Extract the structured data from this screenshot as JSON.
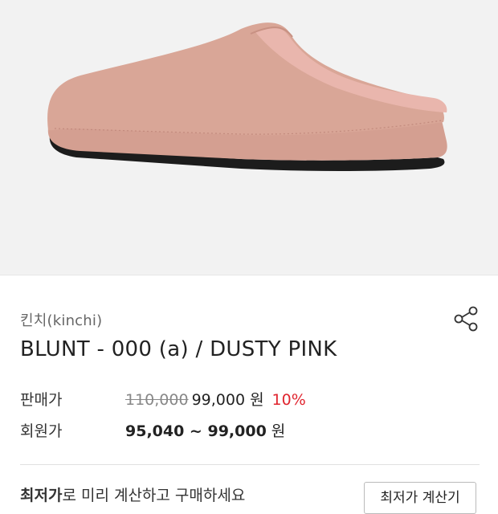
{
  "product": {
    "brand": "킨치(kinchi)",
    "name": "BLUNT - 000 (a) / DUSTY PINK",
    "image_alt": "dusty pink suede mule"
  },
  "pricing": {
    "sale_label": "판매가",
    "original_price": "110,000",
    "sale_price": "99,000",
    "currency": "원",
    "discount": "10%",
    "member_label": "회원가",
    "member_price": "95,040 ~ 99,000"
  },
  "coupon": {
    "message_bold": "최저가",
    "message_rest": "로 미리 계산하고 구매하세요",
    "button_label": "최저가 계산기"
  },
  "icons": {
    "share": "share-icon"
  },
  "colors": {
    "discount": "#e0242e",
    "shoe": "#d9a697",
    "sole": "#1a1a1a"
  }
}
